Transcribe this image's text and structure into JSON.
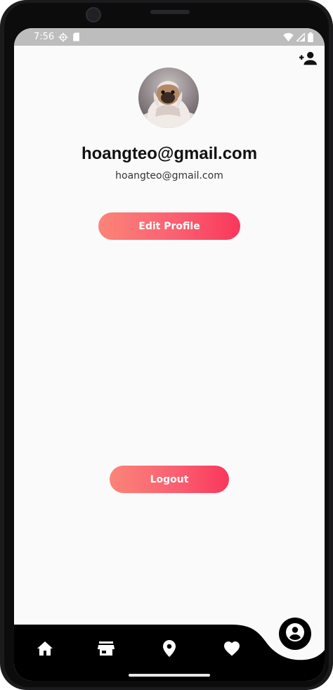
{
  "status_bar": {
    "time": "7:56"
  },
  "profile": {
    "display_name": "hoangteo@gmail.com",
    "email": "hoangteo@gmail.com"
  },
  "actions": {
    "edit_profile_label": "Edit Profile",
    "logout_label": "Logout"
  },
  "nav": {
    "items": [
      "home-icon",
      "store-icon",
      "location-icon",
      "favorite-icon"
    ],
    "active": "account-icon"
  },
  "colors": {
    "accent_start": "#fb8478",
    "accent_end": "#f9375c",
    "navbar": "#000000",
    "background": "#fafafa",
    "status_bar": "#bdbdbd"
  }
}
